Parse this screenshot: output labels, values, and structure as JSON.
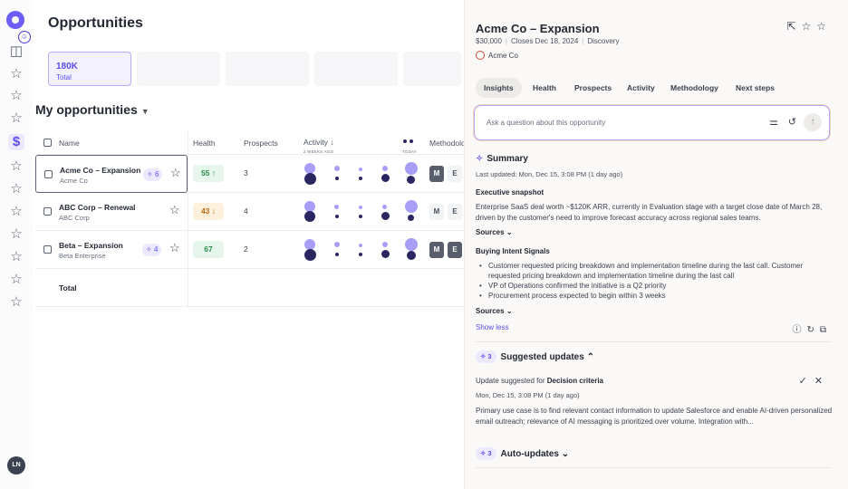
{
  "rail": {
    "avatar_initials": "LN",
    "icons": [
      "layout-icon",
      "star-icon",
      "star-icon",
      "star-icon",
      "dollar-icon",
      "star-icon",
      "star-icon",
      "star-icon",
      "star-icon",
      "star-icon",
      "star-icon",
      "star-icon"
    ],
    "active_color": "#5b4ee8"
  },
  "main": {
    "title": "Opportunities",
    "kpi": {
      "value": "180K",
      "label": "Total"
    },
    "section_title": "My opportunities",
    "columns": {
      "name": "Name",
      "health": "Health",
      "prospects": "Prospects",
      "activity": "Activity",
      "activity_sort": "↓",
      "activity_from": "2 WEEKS AGO",
      "activity_to": "TODAY",
      "methodology": "Methodolo"
    },
    "rows": [
      {
        "name": "Acme Co – Expansion",
        "sub": "Acme Co",
        "suggestions": "6",
        "health": "55 ↑",
        "health_tone": "green",
        "prospects": "3",
        "meth": [
          "M",
          "E"
        ]
      },
      {
        "name": "ABC Corp – Renewal",
        "sub": "ABC Corp",
        "suggestions": "",
        "health": "43 ↓",
        "health_tone": "orange",
        "prospects": "4",
        "meth": [
          "M",
          "E"
        ]
      },
      {
        "name": "Beta – Expansion",
        "sub": "Beta Enterprise",
        "suggestions": "4",
        "health": "67",
        "health_tone": "green",
        "prospects": "2",
        "meth": [
          "M",
          "E"
        ]
      }
    ],
    "total_label": "Total"
  },
  "panel": {
    "title": "Acme Co – Expansion",
    "amount": "$30,000",
    "close": "Closes Dec 18, 2024",
    "stage": "Discovery",
    "account": "Acme Co",
    "tabs": [
      "Insights",
      "Health",
      "Prospects",
      "Activity",
      "Methodology",
      "Next steps"
    ],
    "active_tab": "Insights",
    "ask_placeholder": "Ask a question about this opportunity",
    "summary": {
      "title": "Summary",
      "updated": "Last updated: Mon, Dec 15, 3:08 PM (1 day ago)",
      "exec_title": "Executive snapshot",
      "exec_text": "Enterprise SaaS deal worth ~$120K ARR, currently in Evaluation stage with a target close date of March 28, driven by the customer's need to improve forecast accuracy across regional sales teams.",
      "sources_label": "Sources",
      "intent_title": "Buying Intent Signals",
      "intent_bullets": [
        "Customer requested pricing breakdown and implementation timeline during the last call. Customer requested pricing breakdown and implementation timeline during the last call",
        "VP of Operations confirmed the initiative is a Q2 priority",
        "Procurement process expected to begin within 3 weeks"
      ],
      "show_less": "Show less"
    },
    "suggested": {
      "count": "3",
      "title": "Suggested updates",
      "update_prefix": "Update suggested for",
      "update_field": "Decision criteria",
      "update_time": "Mon, Dec 15, 3:08 PM (1 day ago)",
      "update_text": "Primary use case is to find relevant contact information to update Salesforce and enable AI-driven personalized email outreach; relevance of AI messaging is prioritized over volume. Integration with..."
    },
    "auto": {
      "count": "3",
      "title": "Auto-updates"
    }
  }
}
